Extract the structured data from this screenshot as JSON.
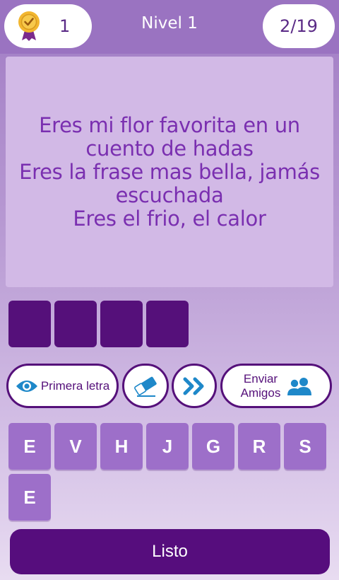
{
  "header": {
    "coins": "1",
    "level_title": "Nivel 1",
    "progress": "2/19"
  },
  "lyrics": {
    "lines": [
      "Eres mi flor favorita en un",
      "cuento de hadas",
      "Eres la frase mas bella, jamás",
      "escuchada",
      "Eres el frio, el calor"
    ]
  },
  "answer": {
    "slots": [
      "",
      "",
      "",
      ""
    ]
  },
  "hints": {
    "first_letter_label": "Primera letra",
    "friends_line1": "Enviar",
    "friends_line2": "Amigos"
  },
  "keyboard": {
    "keys": [
      "E",
      "V",
      "H",
      "J",
      "G",
      "R",
      "S",
      "E"
    ]
  },
  "submit_label": "Listo",
  "colors": {
    "primary": "#55107a",
    "key": "#9d6fc9",
    "lyrics_text": "#7a2fb0",
    "hint_icon": "#1e88c9",
    "medal_gold": "#f2b630"
  },
  "icons": {
    "coins": "medal-icon",
    "first_letter": "eye-icon",
    "erase": "eraser-icon",
    "skip": "double-chevron-right-icon",
    "friends": "people-icon"
  }
}
